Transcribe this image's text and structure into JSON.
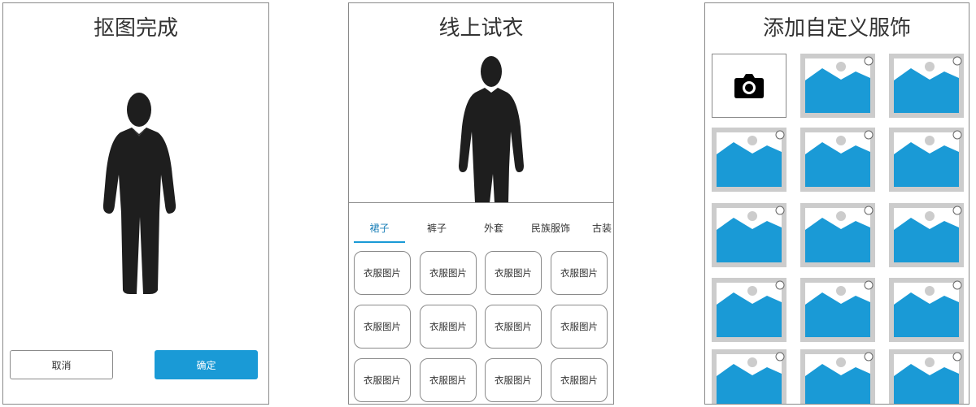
{
  "screen1": {
    "title": "抠图完成",
    "cancel_label": "取消",
    "confirm_label": "确定",
    "accent_color": "#1a9ad6"
  },
  "screen2": {
    "title": "线上试衣",
    "tabs": [
      {
        "label": "裙子",
        "active": true
      },
      {
        "label": "裤子",
        "active": false
      },
      {
        "label": "外套",
        "active": false
      },
      {
        "label": "民族服饰",
        "active": false
      },
      {
        "label": "古装",
        "active": false
      }
    ],
    "clothes": [
      {
        "label": "衣服图片"
      },
      {
        "label": "衣服图片"
      },
      {
        "label": "衣服图片"
      },
      {
        "label": "衣服图片"
      },
      {
        "label": "衣服图片"
      },
      {
        "label": "衣服图片"
      },
      {
        "label": "衣服图片"
      },
      {
        "label": "衣服图片"
      },
      {
        "label": "衣服图片"
      },
      {
        "label": "衣服图片"
      },
      {
        "label": "衣服图片"
      },
      {
        "label": "衣服图片"
      }
    ]
  },
  "screen3": {
    "title": "添加自定义服饰",
    "camera_icon": "camera-icon",
    "image_icon": "image-placeholder-icon",
    "image_color": "#1a9ad6",
    "frame_color": "#cccccc"
  }
}
